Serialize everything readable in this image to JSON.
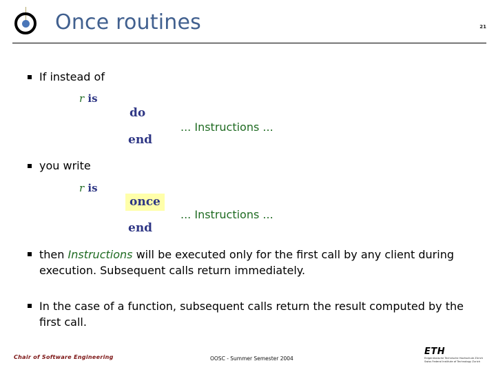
{
  "header": {
    "title": "Once routines",
    "page_number": "21",
    "logo_icon": "target-dot-icon",
    "logo_ring_color": "#000000",
    "logo_dot_color": "#4a76b8",
    "logo_stem_color": "#b5a96a",
    "title_color": "#41608f"
  },
  "colors": {
    "keyword": "#2f3785",
    "identifier_green": "#1f6b22",
    "highlight": "#ffffaa",
    "footer_red": "#7b1313"
  },
  "body": {
    "bullet_glyph": "square-bullet-icon",
    "bullets": [
      {
        "id": "if-instead-of",
        "text": "If instead of"
      },
      {
        "id": "you-write",
        "text": "you write"
      }
    ],
    "snippet_before": {
      "signature_var": "r",
      "signature_kw": "is",
      "open_kw": "do",
      "instructions": "... Instructions ...",
      "close_kw": "end"
    },
    "snippet_after": {
      "signature_var": "r",
      "signature_kw": "is",
      "open_kw": "once",
      "instructions": "... Instructions ...",
      "close_kw": "end"
    },
    "paragraph_3": {
      "lead": "then",
      "emphasis": "Instructions",
      "rest": "will be executed only for the first call by any client during execution. Subsequent calls return immediately."
    },
    "paragraph_4": {
      "text": "In the case of a function, subsequent calls return the result computed by the first call."
    }
  },
  "footer": {
    "left": "Chair of Software Engineering",
    "center": "OOSC - Summer Semester 2004",
    "eth_word": "ETH",
    "eth_sub_line1": "Eidgenössische Technische Hochschule Zürich",
    "eth_sub_line2": "Swiss Federal Institute of Technology Zurich"
  }
}
